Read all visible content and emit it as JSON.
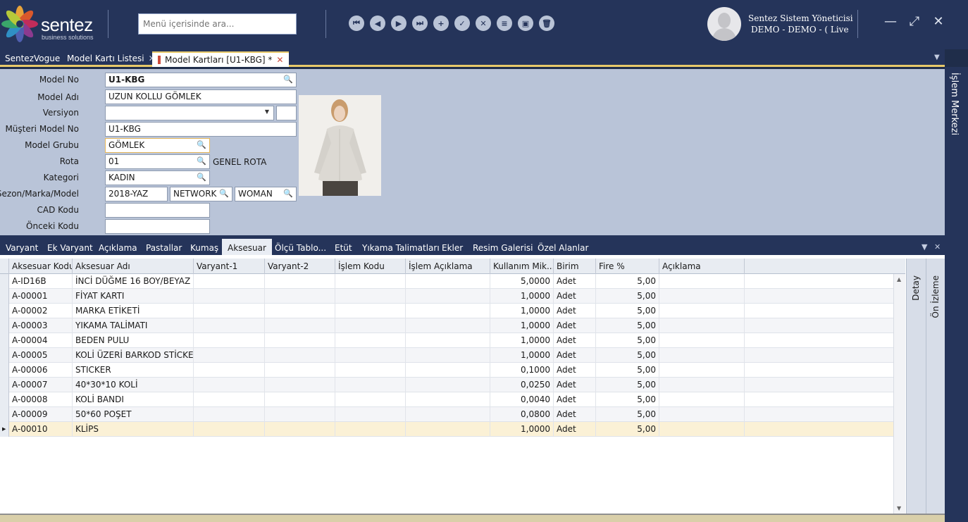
{
  "header": {
    "logo_text": "sentez",
    "logo_sub": "business solutions",
    "search_placeholder": "Menü içerisinde ara...",
    "user_name": "Sentez Sistem Yöneticisi",
    "user_sub": "DEMO - DEMO - ( Live",
    "nav_icons": [
      "first-icon",
      "prev-icon",
      "next-icon",
      "last-icon",
      "add-icon",
      "save-icon",
      "cancel-icon",
      "list-icon",
      "preview-icon",
      "delete-icon"
    ],
    "window_buttons": [
      "minimize",
      "maximize",
      "close"
    ]
  },
  "tabs": [
    {
      "label": "SentezVogue"
    },
    {
      "label": "Model Kartı Listesi",
      "close": "✕"
    },
    {
      "label": "Model Kartları [U1-KBG]  *",
      "close": "✕",
      "active": true
    }
  ],
  "right_panel": {
    "label": "İşlem Merkezi"
  },
  "form": {
    "labels": {
      "model_no": "Model No",
      "model_adi": "Model Adı",
      "versiyon": "Versiyon",
      "musteri_model_no": "Müşteri Model No",
      "model_grubu": "Model Grubu",
      "rota": "Rota",
      "kategori": "Kategori",
      "sezon": "Sezon/Marka/Model",
      "cad_kodu": "CAD Kodu",
      "onceki_kodu": "Önceki Kodu"
    },
    "values": {
      "model_no": "U1-KBG",
      "model_adi": "UZUN KOLLU GÖMLEK",
      "versiyon": "",
      "musteri_model_no": "U1-KBG",
      "model_grubu": "GÖMLEK",
      "rota": "01",
      "rota_desc": "GENEL ROTA",
      "kategori": "KADIN",
      "sezon": "2018-YAZ",
      "marka": "NETWORK",
      "model": "WOMAN",
      "cad_kodu": "",
      "onceki_kodu": ""
    }
  },
  "detail_tabs": [
    "Varyant",
    "Ek Varyant",
    "Açıklama",
    "Pastallar",
    "Kumaş",
    "Aksesuar",
    "Ölçü Tablo...",
    "Etüt",
    "Yıkama Talimatları",
    "Ekler",
    "Resim Galerisi",
    "Özel Alanlar"
  ],
  "detail_tab_active": "Aksesuar",
  "grid": {
    "columns": [
      "Aksesuar Kodu",
      "Aksesuar Adı",
      "Varyant-1",
      "Varyant-2",
      "İşlem Kodu",
      "İşlem Açıklama",
      "Kullanım Mik...",
      "Birim",
      "Fire %",
      "Açıklama"
    ],
    "rows": [
      [
        "A-ID16B",
        "İNCİ DÜĞME 16 BOY/BEYAZ",
        "",
        "",
        "",
        "",
        "5,0000",
        "Adet",
        "5,00",
        ""
      ],
      [
        "A-00001",
        "FİYAT KARTI",
        "",
        "",
        "",
        "",
        "1,0000",
        "Adet",
        "5,00",
        ""
      ],
      [
        "A-00002",
        "MARKA ETİKETİ",
        "",
        "",
        "",
        "",
        "1,0000",
        "Adet",
        "5,00",
        ""
      ],
      [
        "A-00003",
        "YIKAMA TALİMATI",
        "",
        "",
        "",
        "",
        "1,0000",
        "Adet",
        "5,00",
        ""
      ],
      [
        "A-00004",
        "BEDEN PULU",
        "",
        "",
        "",
        "",
        "1,0000",
        "Adet",
        "5,00",
        ""
      ],
      [
        "A-00005",
        "KOLİ ÜZERİ BARKOD STİCKER",
        "",
        "",
        "",
        "",
        "1,0000",
        "Adet",
        "5,00",
        ""
      ],
      [
        "A-00006",
        "STICKER",
        "",
        "",
        "",
        "",
        "0,1000",
        "Adet",
        "5,00",
        ""
      ],
      [
        "A-00007",
        "40*30*10 KOLİ",
        "",
        "",
        "",
        "",
        "0,0250",
        "Adet",
        "5,00",
        ""
      ],
      [
        "A-00008",
        "KOLİ BANDI",
        "",
        "",
        "",
        "",
        "0,0040",
        "Adet",
        "5,00",
        ""
      ],
      [
        "A-00009",
        "50*60 POŞET",
        "",
        "",
        "",
        "",
        "0,0800",
        "Adet",
        "5,00",
        ""
      ],
      [
        "A-00010",
        "KLİPS",
        "",
        "",
        "",
        "",
        "1,0000",
        "Adet",
        "5,00",
        ""
      ]
    ],
    "selected_row": 10
  },
  "side_tabs": [
    "Detay",
    "Ön İzleme"
  ]
}
